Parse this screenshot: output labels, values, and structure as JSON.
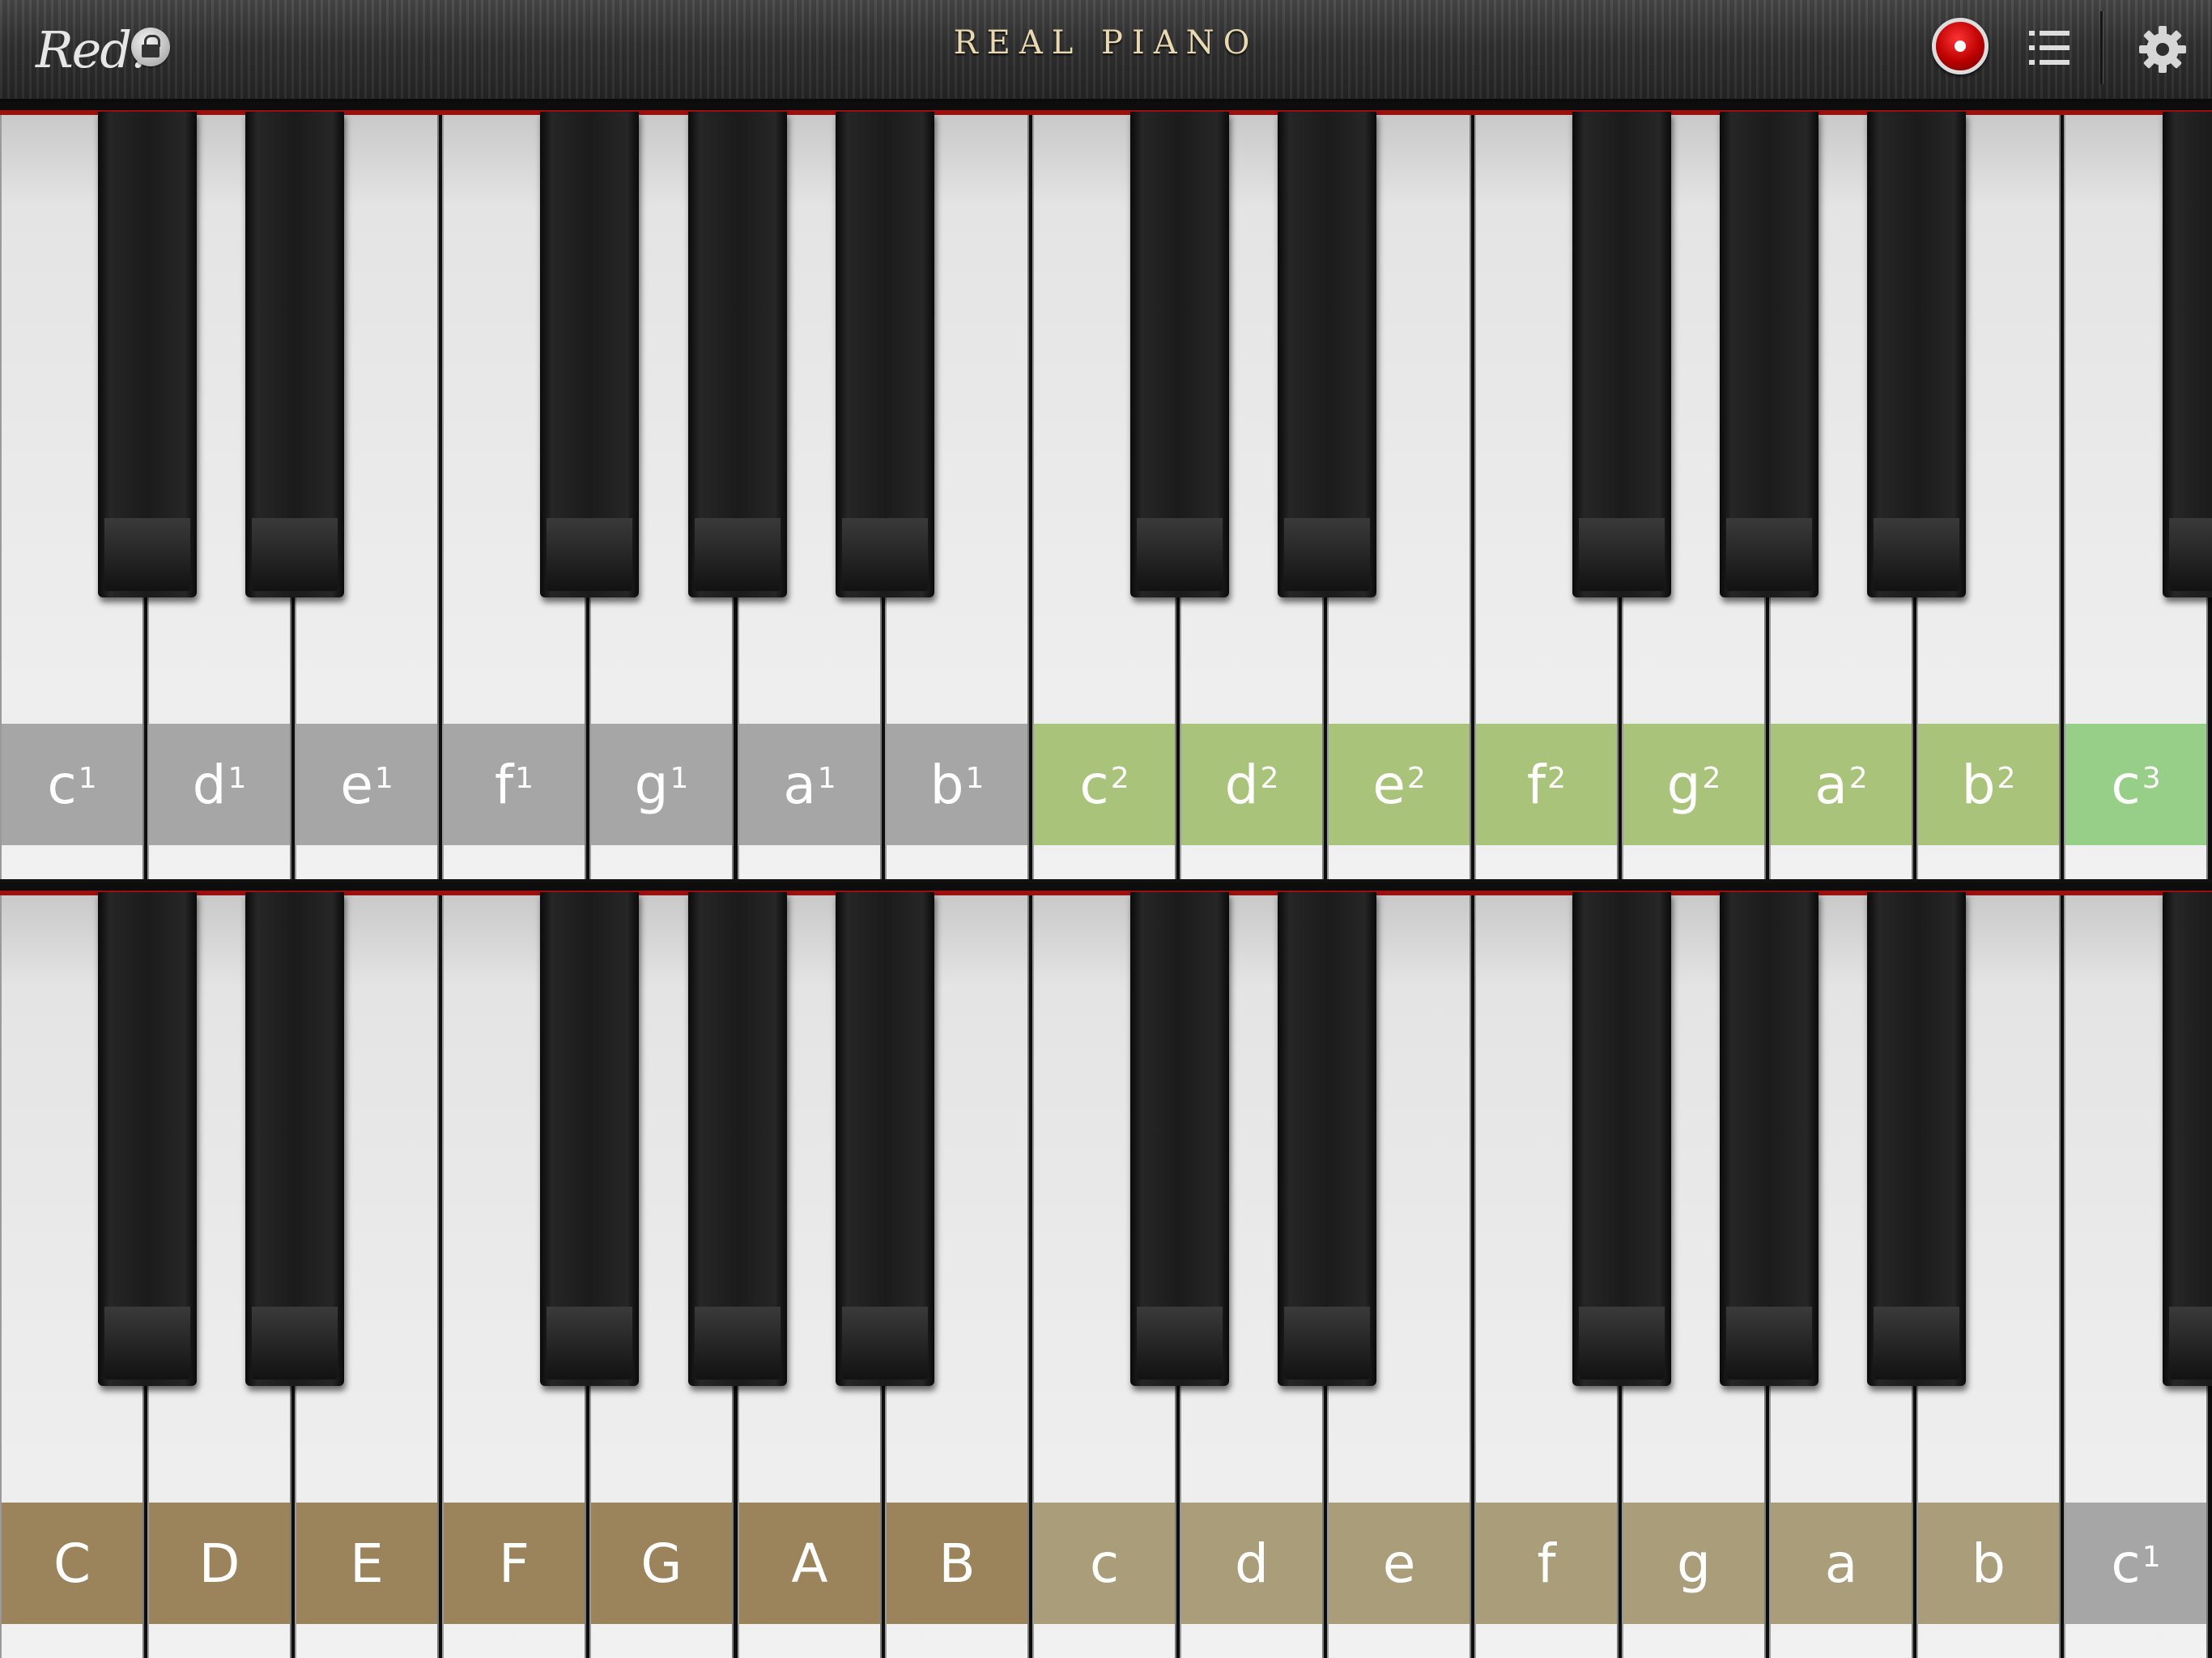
{
  "header": {
    "logo_text": "Red.",
    "title": "REAL PIANO",
    "icons": {
      "lock": "lock-icon",
      "record": "record-icon",
      "list": "list-icon",
      "settings": "gear-icon"
    }
  },
  "keyboards": [
    {
      "name": "upper",
      "white_keys": [
        {
          "note": "c",
          "octave": "1",
          "color": "#a6a6a6"
        },
        {
          "note": "d",
          "octave": "1",
          "color": "#a6a6a6"
        },
        {
          "note": "e",
          "octave": "1",
          "color": "#a6a6a6"
        },
        {
          "note": "f",
          "octave": "1",
          "color": "#a6a6a6"
        },
        {
          "note": "g",
          "octave": "1",
          "color": "#a6a6a6"
        },
        {
          "note": "a",
          "octave": "1",
          "color": "#a6a6a6"
        },
        {
          "note": "b",
          "octave": "1",
          "color": "#a6a6a6"
        },
        {
          "note": "c",
          "octave": "2",
          "color": "#a9c47a"
        },
        {
          "note": "d",
          "octave": "2",
          "color": "#a9c47a"
        },
        {
          "note": "e",
          "octave": "2",
          "color": "#a9c47a"
        },
        {
          "note": "f",
          "octave": "2",
          "color": "#a9c47a"
        },
        {
          "note": "g",
          "octave": "2",
          "color": "#a9c47a"
        },
        {
          "note": "a",
          "octave": "2",
          "color": "#a9c47a"
        },
        {
          "note": "b",
          "octave": "2",
          "color": "#a9c47a"
        },
        {
          "note": "c",
          "octave": "3",
          "color": "#98cf88"
        }
      ]
    },
    {
      "name": "lower",
      "white_keys": [
        {
          "note": "C",
          "octave": "",
          "color": "#9b835c"
        },
        {
          "note": "D",
          "octave": "",
          "color": "#9b835c"
        },
        {
          "note": "E",
          "octave": "",
          "color": "#9b835c"
        },
        {
          "note": "F",
          "octave": "",
          "color": "#9b835c"
        },
        {
          "note": "G",
          "octave": "",
          "color": "#9b835c"
        },
        {
          "note": "A",
          "octave": "",
          "color": "#9b835c"
        },
        {
          "note": "B",
          "octave": "",
          "color": "#9b835c"
        },
        {
          "note": "c",
          "octave": "",
          "color": "#a99d7a"
        },
        {
          "note": "d",
          "octave": "",
          "color": "#a99d7a"
        },
        {
          "note": "e",
          "octave": "",
          "color": "#a99d7a"
        },
        {
          "note": "f",
          "octave": "",
          "color": "#a99d7a"
        },
        {
          "note": "g",
          "octave": "",
          "color": "#a99d7a"
        },
        {
          "note": "a",
          "octave": "",
          "color": "#a99d7a"
        },
        {
          "note": "b",
          "octave": "",
          "color": "#a99d7a"
        },
        {
          "note": "c",
          "octave": "1",
          "color": "#a6a6a6"
        }
      ]
    }
  ]
}
